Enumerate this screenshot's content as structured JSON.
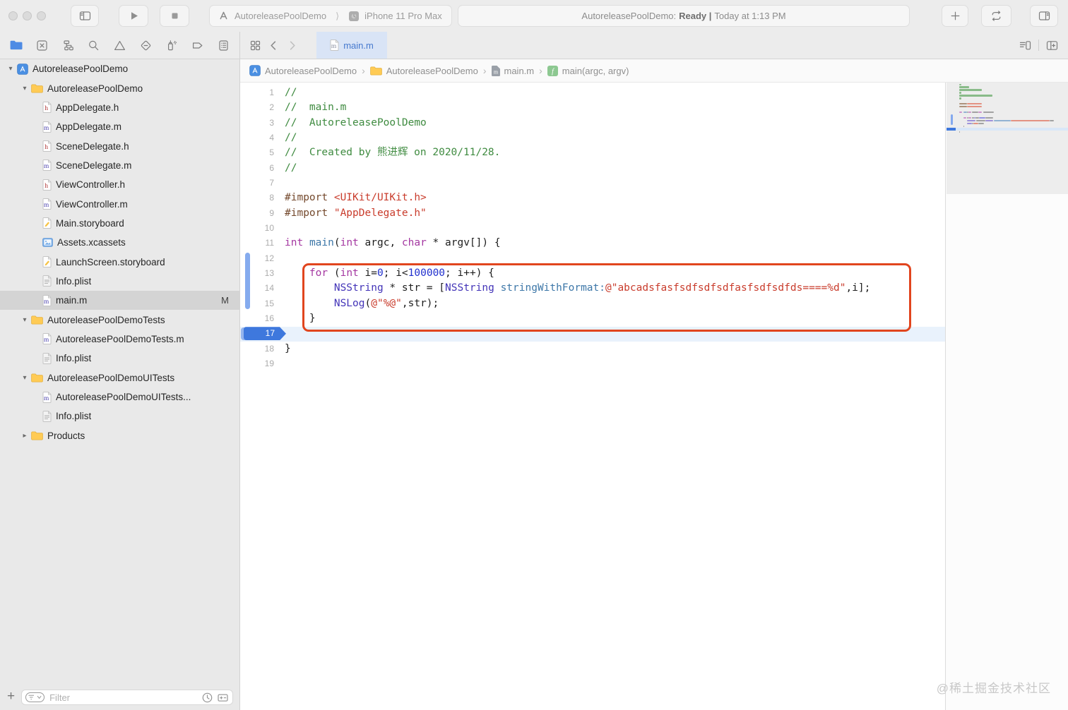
{
  "toolbar": {
    "scheme": {
      "project": "AutoreleasePoolDemo",
      "device": "iPhone 11 Pro Max"
    },
    "status": {
      "name": "AutoreleasePoolDemo:",
      "state": "Ready |",
      "time": "Today at 1:13 PM"
    }
  },
  "navigator_icons": [
    "project-navigator",
    "source-control",
    "symbol-navigator",
    "find-navigator",
    "issue-navigator",
    "test-navigator",
    "debug-navigator",
    "breakpoint-navigator",
    "report-navigator"
  ],
  "tabbar": {
    "active_tab": "main.m"
  },
  "breadcrumb": [
    {
      "label": "AutoreleasePoolDemo",
      "icon": "project"
    },
    {
      "label": "AutoreleasePoolDemo",
      "icon": "folder"
    },
    {
      "label": "main.m",
      "icon": "mdoc"
    },
    {
      "label": "main(argc, argv)",
      "icon": "function"
    }
  ],
  "sidebar": {
    "filter_placeholder": "Filter",
    "files": [
      {
        "label": "AutoreleasePoolDemo",
        "icon": "project",
        "level": 0,
        "disclosure": "expanded"
      },
      {
        "label": "AutoreleasePoolDemo",
        "icon": "folder",
        "level": 1,
        "disclosure": "expanded"
      },
      {
        "label": "AppDelegate.h",
        "icon": "h",
        "level": 2
      },
      {
        "label": "AppDelegate.m",
        "icon": "m",
        "level": 2
      },
      {
        "label": "SceneDelegate.h",
        "icon": "h",
        "level": 2
      },
      {
        "label": "SceneDelegate.m",
        "icon": "m",
        "level": 2
      },
      {
        "label": "ViewController.h",
        "icon": "h",
        "level": 2
      },
      {
        "label": "ViewController.m",
        "icon": "m",
        "level": 2
      },
      {
        "label": "Main.storyboard",
        "icon": "storyboard",
        "level": 2
      },
      {
        "label": "Assets.xcassets",
        "icon": "assets",
        "level": 2
      },
      {
        "label": "LaunchScreen.storyboard",
        "icon": "storyboard",
        "level": 2
      },
      {
        "label": "Info.plist",
        "icon": "plist",
        "level": 2
      },
      {
        "label": "main.m",
        "icon": "m",
        "level": 2,
        "selected": true,
        "badge": "M"
      },
      {
        "label": "AutoreleasePoolDemoTests",
        "icon": "folder",
        "level": 1,
        "disclosure": "expanded"
      },
      {
        "label": "AutoreleasePoolDemoTests.m",
        "icon": "m",
        "level": 2
      },
      {
        "label": "Info.plist",
        "icon": "plist",
        "level": 2
      },
      {
        "label": "AutoreleasePoolDemoUITests",
        "icon": "folder",
        "level": 1,
        "disclosure": "expanded"
      },
      {
        "label": "AutoreleasePoolDemoUITests...",
        "icon": "m",
        "level": 2
      },
      {
        "label": "Info.plist",
        "icon": "plist",
        "level": 2
      },
      {
        "label": "Products",
        "icon": "folder",
        "level": 1,
        "disclosure": "collapsed"
      }
    ]
  },
  "editor": {
    "breakpoint_line": 17,
    "highlighted_line": 17,
    "annotation_lines": {
      "from": 13,
      "to": 17
    },
    "lines": [
      {
        "n": 1,
        "segs": [
          [
            "comment",
            "//"
          ]
        ]
      },
      {
        "n": 2,
        "segs": [
          [
            "comment",
            "//  main.m"
          ]
        ]
      },
      {
        "n": 3,
        "segs": [
          [
            "comment",
            "//  AutoreleasePoolDemo"
          ]
        ]
      },
      {
        "n": 4,
        "segs": [
          [
            "comment",
            "//"
          ]
        ]
      },
      {
        "n": 5,
        "segs": [
          [
            "comment",
            "//  Created by 熊进辉 on 2020/11/28."
          ]
        ]
      },
      {
        "n": 6,
        "segs": [
          [
            "comment",
            "//"
          ]
        ]
      },
      {
        "n": 7,
        "segs": []
      },
      {
        "n": 8,
        "segs": [
          [
            "preproc",
            "#import "
          ],
          [
            "string",
            "<UIKit/UIKit.h>"
          ]
        ]
      },
      {
        "n": 9,
        "segs": [
          [
            "preproc",
            "#import "
          ],
          [
            "string",
            "\"AppDelegate.h\""
          ]
        ]
      },
      {
        "n": 10,
        "segs": []
      },
      {
        "n": 11,
        "segs": [
          [
            "keyword",
            "int"
          ],
          [
            "plain",
            " "
          ],
          [
            "func",
            "main"
          ],
          [
            "plain",
            "("
          ],
          [
            "keyword",
            "int"
          ],
          [
            "plain",
            " argc, "
          ],
          [
            "keyword",
            "char"
          ],
          [
            "plain",
            " * argv[]) {"
          ]
        ]
      },
      {
        "n": 12,
        "segs": []
      },
      {
        "n": 13,
        "segs": [
          [
            "plain",
            "    "
          ],
          [
            "keyword",
            "for"
          ],
          [
            "plain",
            " ("
          ],
          [
            "keyword",
            "int"
          ],
          [
            "plain",
            " i="
          ],
          [
            "number",
            "0"
          ],
          [
            "plain",
            "; i<"
          ],
          [
            "number",
            "100000"
          ],
          [
            "plain",
            "; i++) {"
          ]
        ]
      },
      {
        "n": 14,
        "segs": [
          [
            "plain",
            "        "
          ],
          [
            "type",
            "NSString"
          ],
          [
            "plain",
            " * str = ["
          ],
          [
            "type",
            "NSString"
          ],
          [
            "plain",
            " "
          ],
          [
            "func",
            "stringWithFormat:"
          ],
          [
            "string",
            "@\"abcadsfasfsdfsdfsdfasfsdfsdfds====%d\""
          ],
          [
            "plain",
            ",i];"
          ]
        ]
      },
      {
        "n": 15,
        "segs": [
          [
            "plain",
            "        "
          ],
          [
            "type",
            "NSLog"
          ],
          [
            "plain",
            "("
          ],
          [
            "string",
            "@\"%@\""
          ],
          [
            "plain",
            ",str);"
          ]
        ]
      },
      {
        "n": 16,
        "segs": [
          [
            "plain",
            "    }"
          ]
        ]
      },
      {
        "n": 17,
        "segs": []
      },
      {
        "n": 18,
        "segs": [
          [
            "plain",
            "}"
          ]
        ]
      },
      {
        "n": 19,
        "segs": []
      }
    ]
  },
  "watermark": "@稀土掘金技术社区",
  "colors": {
    "annotation_red": "#E1451E",
    "breakpoint_blue": "#3E78DD",
    "active_tab_bg": "#D9E4F6",
    "active_tab_text": "#4679CE",
    "syntax": {
      "comment": "#3F8B40",
      "preproc": "#74492D",
      "string": "#C93C2C",
      "number": "#2130CE",
      "keyword": "#A437A1",
      "type": "#4334B8",
      "func": "#3D77A8",
      "plain": "#1E1E1E"
    }
  }
}
